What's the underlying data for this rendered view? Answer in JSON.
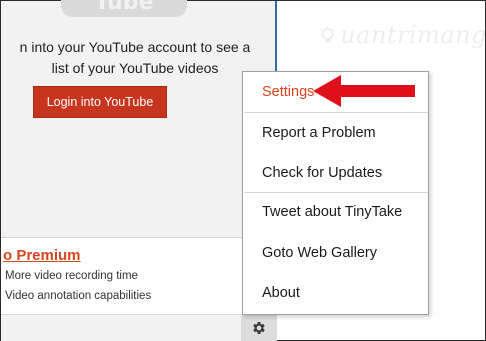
{
  "panel": {
    "logo_text": "Tube",
    "message_line1": "n into your YouTube account to see a",
    "message_line2": "list of your YouTube videos",
    "login_button": "Login into YouTube",
    "premium_link": "o Premium",
    "features": [
      "More video recording time",
      "Video annotation capabilities"
    ]
  },
  "watermark": {
    "text": "uantrimang"
  },
  "menu": {
    "items": [
      {
        "label": "Settings"
      },
      {
        "label": "Report a Problem"
      },
      {
        "label": "Check for Updates"
      },
      {
        "label": "Tweet about TinyTake"
      },
      {
        "label": "Goto Web Gallery"
      },
      {
        "label": "About"
      }
    ]
  },
  "icons": {
    "settings": "gear-icon",
    "annotation": "red-arrow-icon",
    "watermark_logo": "lightbulb-icon"
  },
  "colors": {
    "accent": "#d6461f",
    "button": "#c8351e",
    "panel_border": "#2a6f9f",
    "arrow": "#e0101a"
  }
}
